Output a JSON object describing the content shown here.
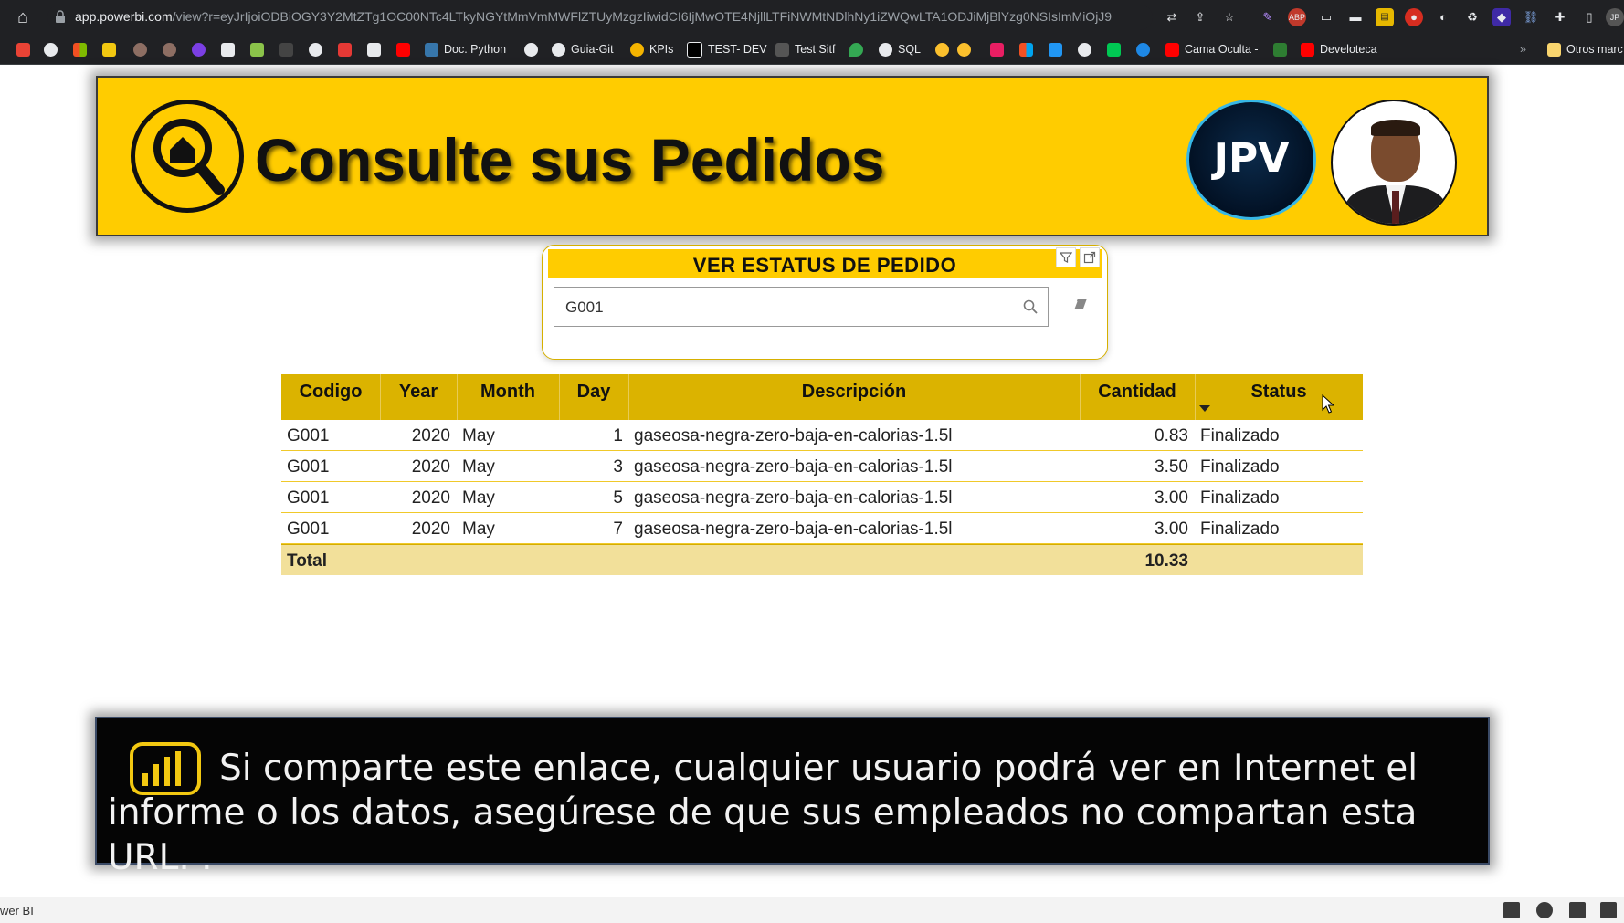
{
  "browser": {
    "url_host": "app.powerbi.com",
    "url_path": "/view?r=eyJrIjoiODBiOGY3Y2MtZTg1OC00NTc4LTkyNGYtMmVmMWFlZTUyMzgzIiwidCI6IjMwOTE4NjllLTFiNWMtNDlhNy1iZWQwLTA1ODJiMjBlYzg0NSIsImMiOjJ9",
    "bookmarks": [
      "Doc. Python",
      "Guia-Git",
      "KPIs",
      "TEST- DEV",
      "Test Sitf",
      "SQL",
      "Cama Oculta -",
      "Develoteca",
      "Otros marc"
    ]
  },
  "header": {
    "title": "Consulte sus Pedidos",
    "badge_text": "JPV"
  },
  "slicer": {
    "title": "VER ESTATUS DE PEDIDO",
    "search_value": "G001"
  },
  "table": {
    "columns": [
      "Codigo",
      "Year",
      "Month",
      "Day",
      "Descripción",
      "Cantidad",
      "Status"
    ],
    "rows": [
      {
        "codigo": "G001",
        "year": "2020",
        "month": "May",
        "day": "1",
        "descripcion": "gaseosa-negra-zero-baja-en-calorias-1.5l",
        "cantidad": "0.83",
        "status": "Finalizado"
      },
      {
        "codigo": "G001",
        "year": "2020",
        "month": "May",
        "day": "3",
        "descripcion": "gaseosa-negra-zero-baja-en-calorias-1.5l",
        "cantidad": "3.50",
        "status": "Finalizado"
      },
      {
        "codigo": "G001",
        "year": "2020",
        "month": "May",
        "day": "5",
        "descripcion": "gaseosa-negra-zero-baja-en-calorias-1.5l",
        "cantidad": "3.00",
        "status": "Finalizado"
      },
      {
        "codigo": "G001",
        "year": "2020",
        "month": "May",
        "day": "7",
        "descripcion": "gaseosa-negra-zero-baja-en-calorias-1.5l",
        "cantidad": "3.00",
        "status": "Finalizado"
      }
    ],
    "total_label": "Total",
    "total_cantidad": "10.33"
  },
  "footer": {
    "message": "Si comparte este enlace, cualquier usuario podrá ver en Internet el informe o los datos, asegúrese de que sus empleados no compartan esta URL. ."
  },
  "status_bar": {
    "label": "wer BI"
  },
  "colors": {
    "accent_yellow": "#ffcc00",
    "header_gold": "#dbb300",
    "total_bg": "#f2e09a",
    "footer_bg": "#050505"
  }
}
